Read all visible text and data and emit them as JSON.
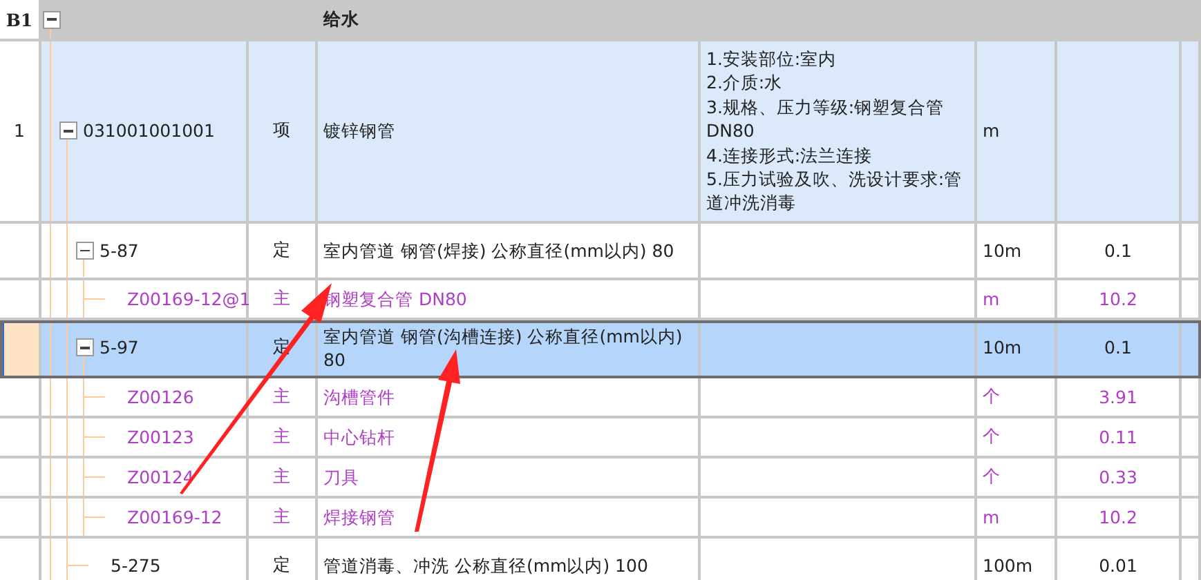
{
  "section": {
    "number": "B1",
    "title": "给水",
    "expanded": true,
    "children": [
      {
        "kind": "item",
        "number": "1",
        "code": "031001001001",
        "type": "项",
        "name": "镀锌钢管",
        "description": "1.安装部位:室内\n2.介质:水\n3.规格、压力等级:钢塑复合管 DN80\n4.连接形式:法兰连接\n5.压力试验及吹、洗设计要求:管道冲洗消毒",
        "unit": "m",
        "expanded": true,
        "selected": false,
        "children": [
          {
            "kind": "quota",
            "code": "5-87",
            "type": "定",
            "name": "室内管道 钢管(焊接) 公称直径(mm以内) 80",
            "unit": "10m",
            "quantity": "0.1",
            "expanded": true,
            "selected": false,
            "children": [
              {
                "kind": "material",
                "code": "Z00169-12@1",
                "type": "主",
                "name": "钢塑复合管 DN80",
                "unit": "m",
                "quantity": "10.2",
                "selected": false
              }
            ]
          },
          {
            "kind": "quota",
            "code": "5-97",
            "type": "定",
            "name": "室内管道 钢管(沟槽连接) 公称直径(mm以内) 80",
            "unit": "10m",
            "quantity": "0.1",
            "expanded": true,
            "selected": true,
            "children": [
              {
                "kind": "material",
                "code": "Z00126",
                "type": "主",
                "name": "沟槽管件",
                "unit": "个",
                "quantity": "3.91",
                "selected": false
              },
              {
                "kind": "material",
                "code": "Z00123",
                "type": "主",
                "name": "中心钻杆",
                "unit": "个",
                "quantity": "0.11",
                "selected": false
              },
              {
                "kind": "material",
                "code": "Z00124",
                "type": "主",
                "name": "刀具",
                "unit": "个",
                "quantity": "0.33",
                "selected": false
              },
              {
                "kind": "material",
                "code": "Z00169-12",
                "type": "主",
                "name": "焊接钢管",
                "unit": "m",
                "quantity": "10.2",
                "selected": false
              }
            ]
          },
          {
            "kind": "quota",
            "code": "5-275",
            "type": "定",
            "name": "管道消毒、冲洗 公称直径(mm以内) 100",
            "unit": "100m",
            "quantity": "0.01",
            "selected": false
          }
        ]
      }
    ]
  }
}
